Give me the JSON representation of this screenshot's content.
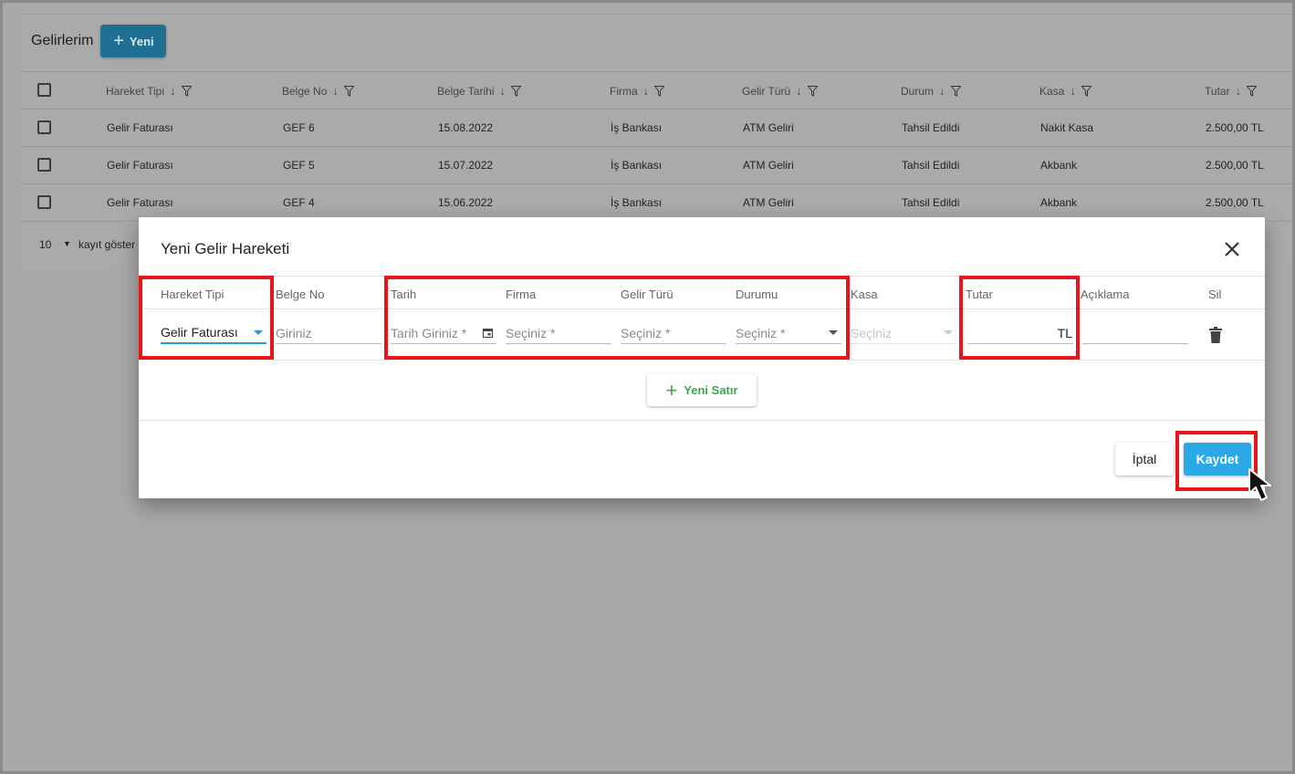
{
  "background": {
    "title": "Gelirlerim",
    "new_button": "Yeni",
    "columns": [
      "Hareket Tipi",
      "Belge No",
      "Belge Tarihi",
      "Firma",
      "Gelir Türü",
      "Durum",
      "Kasa",
      "Tutar"
    ],
    "rows": [
      [
        "Gelir Faturası",
        "GEF 6",
        "15.08.2022",
        "İş Bankası",
        "ATM Geliri",
        "Tahsil Edildi",
        "Nakit Kasa",
        "2.500,00 TL"
      ],
      [
        "Gelir Faturası",
        "GEF 5",
        "15.07.2022",
        "İş Bankası",
        "ATM Geliri",
        "Tahsil Edildi",
        "Akbank",
        "2.500,00 TL"
      ],
      [
        "Gelir Faturası",
        "GEF 4",
        "15.06.2022",
        "İş Bankası",
        "ATM Geliri",
        "Tahsil Edildi",
        "Akbank",
        "2.500,00 TL"
      ]
    ],
    "page_size": "10",
    "page_size_label": "kayıt göster"
  },
  "modal": {
    "title": "Yeni Gelir Hareketi",
    "columns": {
      "hareket_tipi": "Hareket Tipi",
      "belge_no": "Belge No",
      "tarih": "Tarih",
      "firma": "Firma",
      "gelir_turu": "Gelir Türü",
      "durumu": "Durumu",
      "kasa": "Kasa",
      "tutar": "Tutar",
      "aciklama": "Açıklama",
      "sil": "Sil"
    },
    "row": {
      "hareket_tipi_value": "Gelir Faturası",
      "belge_no_placeholder": "Giriniz",
      "tarih_placeholder": "Tarih Giriniz *",
      "firma_placeholder": "Seçiniz *",
      "gelir_turu_placeholder": "Seçiniz *",
      "durumu_placeholder": "Seçiniz *",
      "kasa_placeholder": "Seçiniz",
      "tutar_suffix": "TL",
      "aciklama_value": ""
    },
    "add_row_button": "Yeni Satır",
    "cancel_button": "İptal",
    "save_button": "Kaydet"
  },
  "colors": {
    "accent": "#2aa9e6",
    "highlight": "#e8151b",
    "add_row": "#3aa74b"
  },
  "icons": [
    "plus-icon",
    "sort-down-icon",
    "filter-icon",
    "close-icon",
    "calendar-icon",
    "trash-icon",
    "dropdown-caret-icon",
    "mouse-cursor-icon"
  ]
}
